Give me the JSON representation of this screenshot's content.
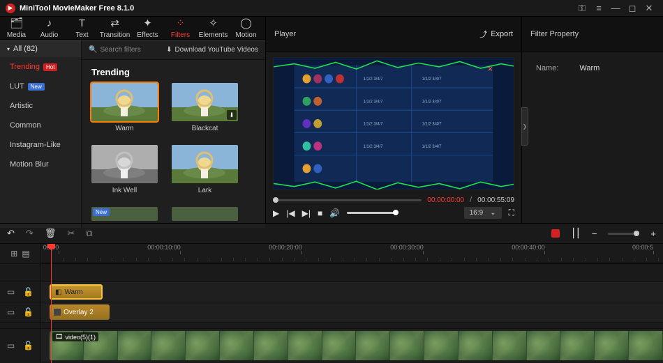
{
  "app": {
    "title": "MiniTool MovieMaker Free 8.1.0"
  },
  "tools": [
    {
      "label": "Media",
      "icon": "🗂"
    },
    {
      "label": "Audio",
      "icon": "♪"
    },
    {
      "label": "Text",
      "icon": "T"
    },
    {
      "label": "Transition",
      "icon": "⇄"
    },
    {
      "label": "Effects",
      "icon": "✦"
    },
    {
      "label": "Filters",
      "icon": "⁘",
      "active": true
    },
    {
      "label": "Elements",
      "icon": "✧"
    },
    {
      "label": "Motion",
      "icon": "◯"
    }
  ],
  "sidebar": {
    "header": "All (82)",
    "categories": [
      {
        "label": "Trending",
        "badge": "Hot",
        "badge_class": "badge-hot",
        "active": true
      },
      {
        "label": "LUT",
        "badge": "New",
        "badge_class": "badge-new"
      },
      {
        "label": "Artistic"
      },
      {
        "label": "Common"
      },
      {
        "label": "Instagram-Like"
      },
      {
        "label": "Motion Blur"
      }
    ]
  },
  "filters": {
    "search_placeholder": "Search filters",
    "download_label": "Download YouTube Videos",
    "section": "Trending",
    "items": [
      {
        "label": "Warm",
        "selected": true
      },
      {
        "label": "Blackcat",
        "dl": true
      },
      {
        "label": "Ink Well",
        "bw": true
      },
      {
        "label": "Lark"
      },
      {
        "label": "",
        "new_tag": "New",
        "partial": true
      },
      {
        "label": "",
        "partial": true
      }
    ]
  },
  "player": {
    "title": "Player",
    "export": "Export",
    "current": "00:00:00:00",
    "total": "00:00:55:09",
    "aspect": "16:9"
  },
  "property": {
    "title": "Filter Property",
    "name_label": "Name:",
    "name_value": "Warm"
  },
  "timeline": {
    "ticks": [
      {
        "label": "00:00",
        "pos": 14
      },
      {
        "label": "00:00:10:00",
        "pos": 176
      },
      {
        "label": "00:00:20:00",
        "pos": 350
      },
      {
        "label": "00:00:30:00",
        "pos": 524
      },
      {
        "label": "00:00:40:00",
        "pos": 698
      },
      {
        "label": "00:00:5",
        "pos": 862
      }
    ],
    "clip_warm": "Warm",
    "clip_overlay": "Overlay 2",
    "clip_video": "video(5)(1)"
  }
}
